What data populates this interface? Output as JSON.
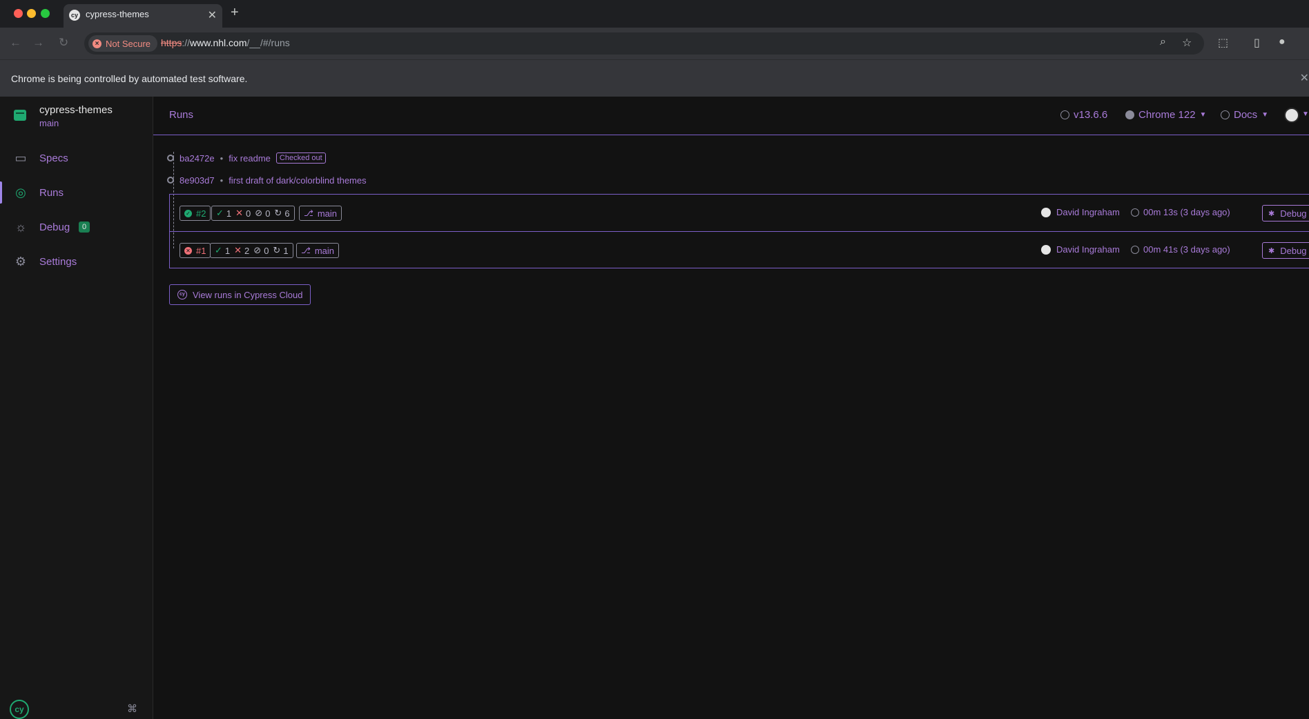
{
  "browser": {
    "tab_title": "cypress-themes",
    "favicon_text": "cy",
    "security_label": "Not Secure",
    "url_scheme": "https",
    "url_sep": "://",
    "url_host": "www.nhl.com",
    "url_path": "/__/#/runs",
    "infobar_text": "Chrome is being controlled by automated test software."
  },
  "sidebar": {
    "project_name": "cypress-themes",
    "project_branch": "main",
    "items": [
      {
        "label": "Specs",
        "icon": "specs-icon"
      },
      {
        "label": "Runs",
        "icon": "runs-icon",
        "active": true
      },
      {
        "label": "Debug",
        "icon": "bug-icon",
        "badge": "0"
      },
      {
        "label": "Settings",
        "icon": "gear-icon"
      }
    ],
    "logo_text": "cy",
    "shortcut_glyph": "⌘"
  },
  "header": {
    "breadcrumb": "Runs",
    "version": "v13.6.6",
    "browser": "Chrome 122",
    "docs": "Docs"
  },
  "commits": [
    {
      "sha": "ba2472e",
      "message": "fix readme",
      "tag": "Checked out"
    },
    {
      "sha": "8e903d7",
      "message": "first draft of dark/colorblind themes"
    }
  ],
  "runs": [
    {
      "number": "#2",
      "status": "pass",
      "passed": "1",
      "failed": "0",
      "skipped": "0",
      "pending": "6",
      "branch": "main",
      "user": "David Ingraham",
      "duration": "00m 13s (3 days ago)",
      "action": "Debug"
    },
    {
      "number": "#1",
      "status": "fail",
      "passed": "1",
      "failed": "2",
      "skipped": "0",
      "pending": "1",
      "branch": "main",
      "user": "David Ingraham",
      "duration": "00m 41s (3 days ago)",
      "action": "Debug"
    }
  ],
  "cloud_button": "View runs in Cypress Cloud",
  "colors": {
    "accent": "#a97bd9",
    "pass": "#1fa971",
    "fail": "#f07178",
    "border": "#7c5fc9"
  }
}
